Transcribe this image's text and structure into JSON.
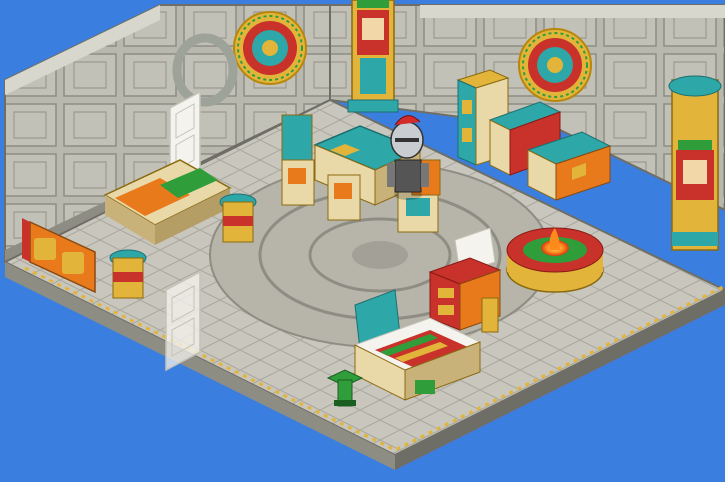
{
  "scene": {
    "kind": "isometric-room",
    "theme": "aztec-temple",
    "colors": {
      "sky": "#3a7fe0",
      "floor": "#c9c7bd",
      "floor_dark": "#a9a79c",
      "wall": "#b9b8ae",
      "wall_dark": "#8e8d84",
      "trim_gold": "#e2b53a",
      "teal": "#2ea7a8",
      "orange": "#e97a1c",
      "red": "#c8322b",
      "green": "#2f9e3a"
    }
  },
  "furniture": {
    "throne_left": "throne",
    "sofa_left": "sofa",
    "desk": "desk",
    "chairs": "chairs",
    "cabinet": "cabinet",
    "chest": "chest",
    "bed": "bed",
    "fire_pit": "fire-pit",
    "dresser": "dresser",
    "calendar_left": "aztec-calendar",
    "calendar_right": "aztec-calendar",
    "statue_left": "tiki-statue",
    "statue_right": "tiki-statue",
    "door_back": "door",
    "door_front": "door"
  },
  "avatar": {
    "name": "",
    "look": "knight-helmet"
  }
}
